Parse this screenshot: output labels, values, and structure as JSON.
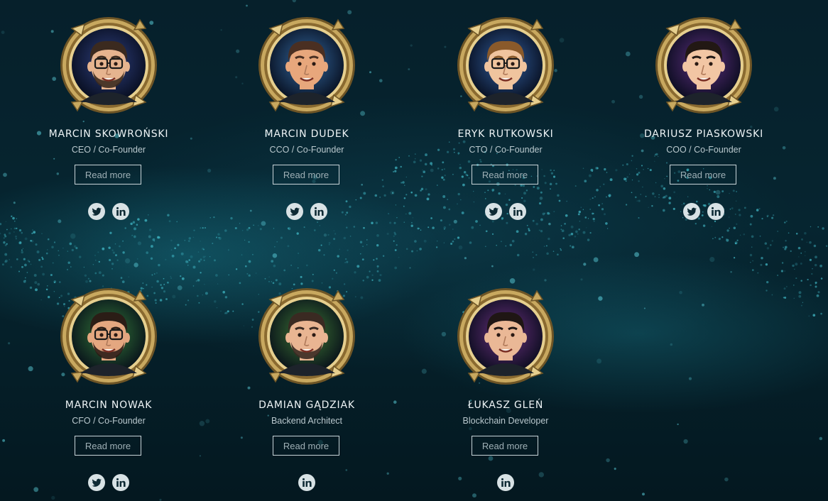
{
  "team": {
    "members": [
      {
        "name": "MARCIN SKOWROŃSKI",
        "role": "CEO / Co-Founder",
        "read_more": "Read more",
        "socials": [
          "twitter-icon",
          "linkedin-icon"
        ],
        "avatar": {
          "bg": "#1a2f7a",
          "hair": "#3b2a1f",
          "skin": "#e6b48f",
          "glasses": true,
          "beard": true
        }
      },
      {
        "name": "MARCIN DUDEK",
        "role": "CCO / Co-Founder",
        "read_more": "Read more",
        "socials": [
          "twitter-icon",
          "linkedin-icon"
        ],
        "avatar": {
          "bg": "#1f5a9c",
          "hair": "#4a2f22",
          "skin": "#e8a77c",
          "glasses": false,
          "beard": false
        }
      },
      {
        "name": "ERYK RUTKOWSKI",
        "role": "CTO / Co-Founder",
        "read_more": "Read more",
        "socials": [
          "twitter-icon",
          "linkedin-icon"
        ],
        "avatar": {
          "bg": "#1d4f9a",
          "hair": "#8a5a2b",
          "skin": "#f0c49e",
          "glasses": true,
          "beard": false
        }
      },
      {
        "name": "DARIUSZ PIASKOWSKI",
        "role": "COO / Co-Founder",
        "read_more": "Read more",
        "socials": [
          "twitter-icon",
          "linkedin-icon"
        ],
        "avatar": {
          "bg": "#4b1d7a",
          "hair": "#221814",
          "skin": "#f2c6a4",
          "glasses": false,
          "beard": false
        }
      },
      {
        "name": "MARCIN NOWAK",
        "role": "CFO / Co-Founder",
        "read_more": "Read more",
        "socials": [
          "twitter-icon",
          "linkedin-icon"
        ],
        "avatar": {
          "bg": "#1f6b2f",
          "hair": "#2b1d16",
          "skin": "#e4a780",
          "glasses": true,
          "beard": true
        }
      },
      {
        "name": "DAMIAN GĄDZIAK",
        "role": "Backend Architect",
        "read_more": "Read more",
        "socials": [
          "linkedin-icon"
        ],
        "avatar": {
          "bg": "#2a6a2a",
          "hair": "#3a2a22",
          "skin": "#e9b592",
          "glasses": false,
          "beard": true
        }
      },
      {
        "name": "ŁUKASZ GLEŃ",
        "role": "Blockchain Developer",
        "read_more": "Read more",
        "socials": [
          "linkedin-icon"
        ],
        "avatar": {
          "bg": "#5a1f7a",
          "hair": "#1f1614",
          "skin": "#eab896",
          "glasses": false,
          "beard": false
        }
      }
    ]
  },
  "colors": {
    "text_primary": "#eef4f6",
    "text_secondary": "#b9c8cd",
    "frame_gold": "#c8a85f",
    "social_bg": "#d8e2e5",
    "social_icon": "#0e2a34"
  }
}
